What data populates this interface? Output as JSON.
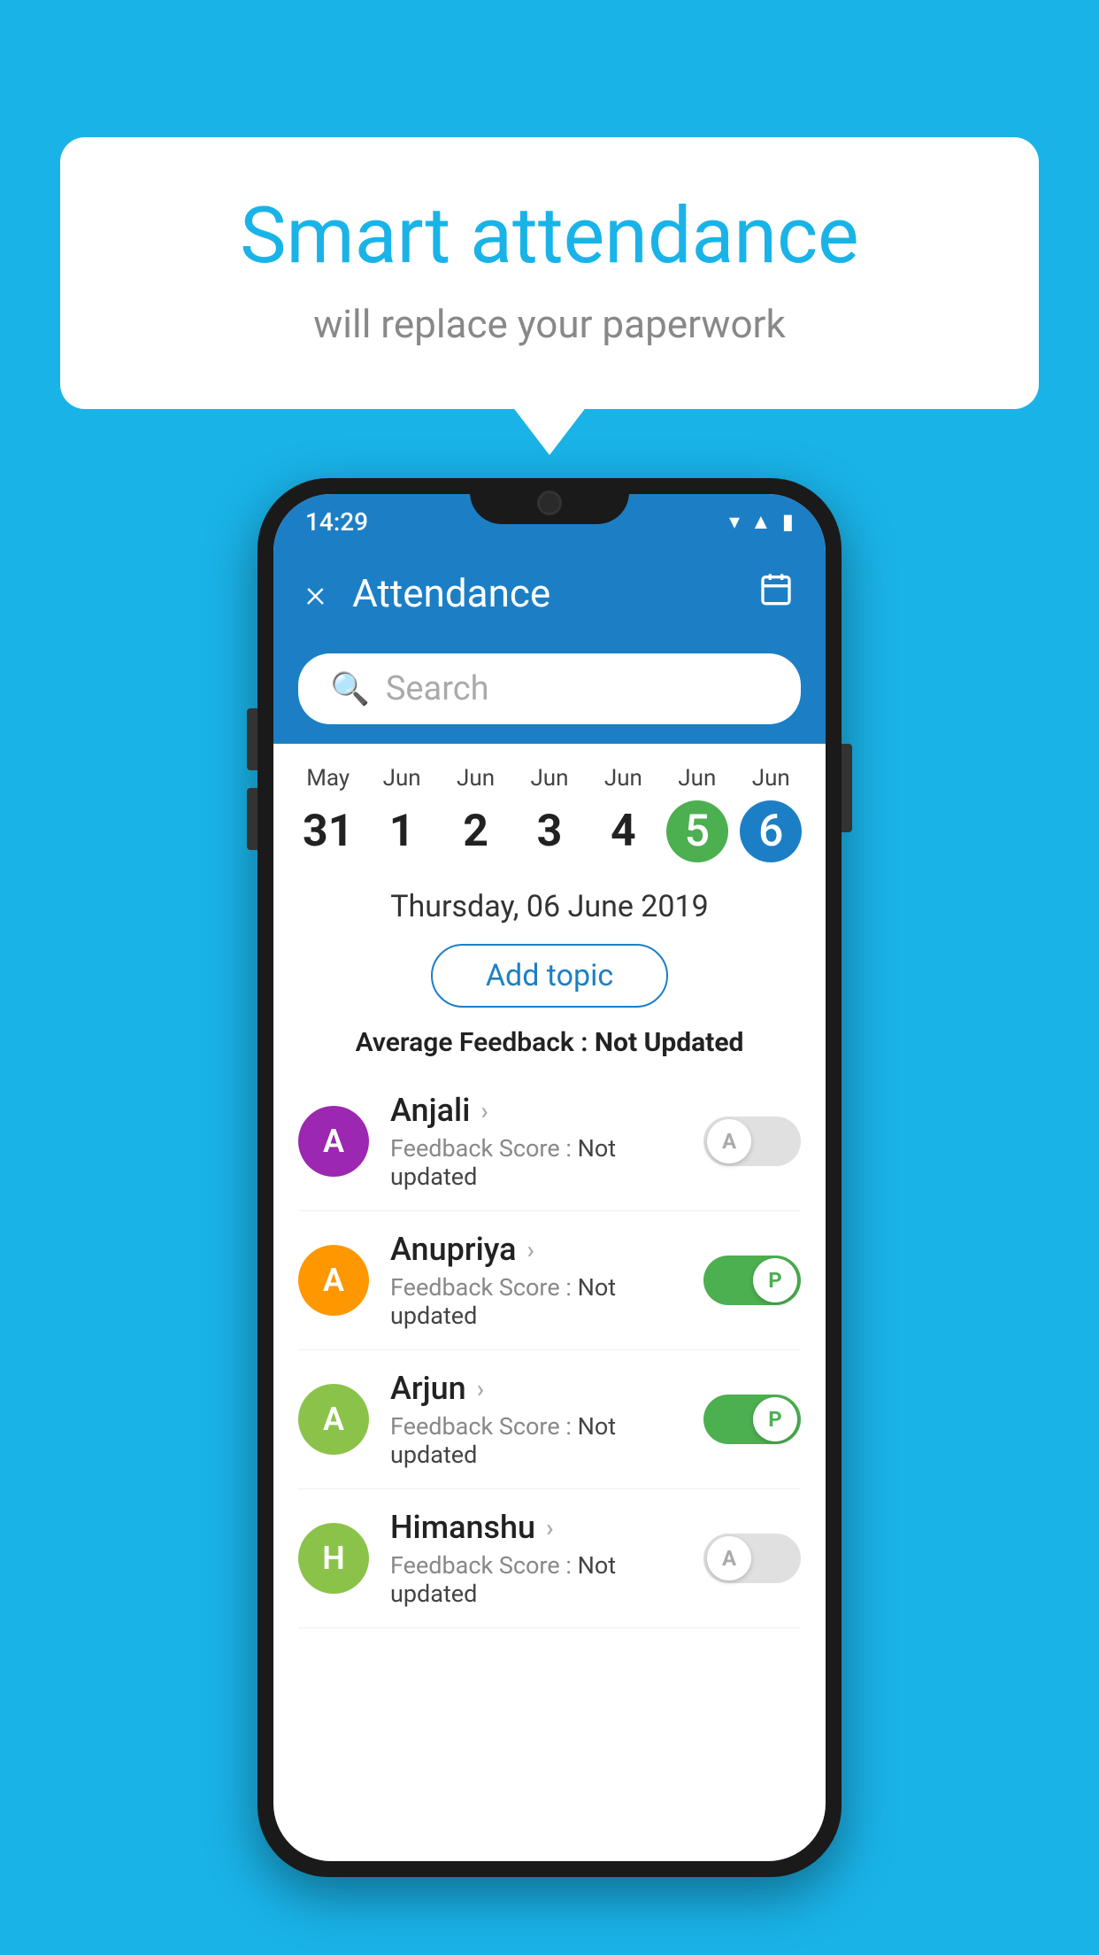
{
  "background_color": "#1ab3e8",
  "speech_bubble": {
    "title": "Smart attendance",
    "subtitle": "will replace your paperwork"
  },
  "phone": {
    "status_bar": {
      "time": "14:29",
      "icons": [
        "wifi",
        "signal",
        "battery"
      ]
    },
    "app_bar": {
      "title": "Attendance",
      "close_label": "×",
      "calendar_icon": "📅"
    },
    "search": {
      "placeholder": "Search"
    },
    "calendar": {
      "days": [
        {
          "month": "May",
          "date": "31",
          "style": "normal"
        },
        {
          "month": "Jun",
          "date": "1",
          "style": "normal"
        },
        {
          "month": "Jun",
          "date": "2",
          "style": "normal"
        },
        {
          "month": "Jun",
          "date": "3",
          "style": "normal"
        },
        {
          "month": "Jun",
          "date": "4",
          "style": "normal"
        },
        {
          "month": "Jun",
          "date": "5",
          "style": "green"
        },
        {
          "month": "Jun",
          "date": "6",
          "style": "blue"
        }
      ]
    },
    "selected_date": "Thursday, 06 June 2019",
    "add_topic_label": "Add topic",
    "avg_feedback_label": "Average Feedback :",
    "avg_feedback_value": "Not Updated",
    "students": [
      {
        "name": "Anjali",
        "avatar_letter": "A",
        "avatar_color": "purple",
        "feedback_label": "Feedback Score :",
        "feedback_value": "Not updated",
        "toggle_state": "off",
        "toggle_label": "A"
      },
      {
        "name": "Anupriya",
        "avatar_letter": "A",
        "avatar_color": "orange",
        "feedback_label": "Feedback Score :",
        "feedback_value": "Not updated",
        "toggle_state": "on",
        "toggle_label": "P"
      },
      {
        "name": "Arjun",
        "avatar_letter": "A",
        "avatar_color": "green",
        "feedback_label": "Feedback Score :",
        "feedback_value": "Not updated",
        "toggle_state": "on",
        "toggle_label": "P"
      },
      {
        "name": "Himanshu",
        "avatar_letter": "H",
        "avatar_color": "lime",
        "feedback_label": "Feedback Score :",
        "feedback_value": "Not updated",
        "toggle_state": "off",
        "toggle_label": "A"
      }
    ]
  }
}
